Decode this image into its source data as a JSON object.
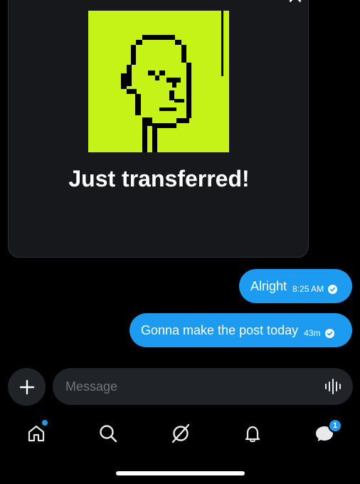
{
  "shared_post": {
    "close_glyph": "×",
    "image_icon": "pixel-punk-portrait",
    "image_background": "#c5f217",
    "caption": "Just transferred!"
  },
  "messages": [
    {
      "text": "Alright",
      "time": "8:25 AM",
      "status_icon": "sent-check-icon"
    },
    {
      "text": "Gonna make the post today",
      "time": "43m",
      "status_icon": "sent-check-icon"
    }
  ],
  "composer": {
    "add_icon": "plus-icon",
    "placeholder": "Message",
    "voice_icon": "voice-waveform-icon"
  },
  "nav": {
    "items": [
      {
        "name": "home",
        "icon": "home-icon",
        "has_dot": true
      },
      {
        "name": "search",
        "icon": "search-icon"
      },
      {
        "name": "grok",
        "icon": "grok-icon"
      },
      {
        "name": "notifications",
        "icon": "bell-icon"
      },
      {
        "name": "messages",
        "icon": "messages-icon",
        "badge": "1"
      }
    ]
  },
  "colors": {
    "accent": "#1d9bf0",
    "background": "#000000",
    "card": "#16181c",
    "input": "#202327",
    "punk_green": "#c5f217"
  }
}
